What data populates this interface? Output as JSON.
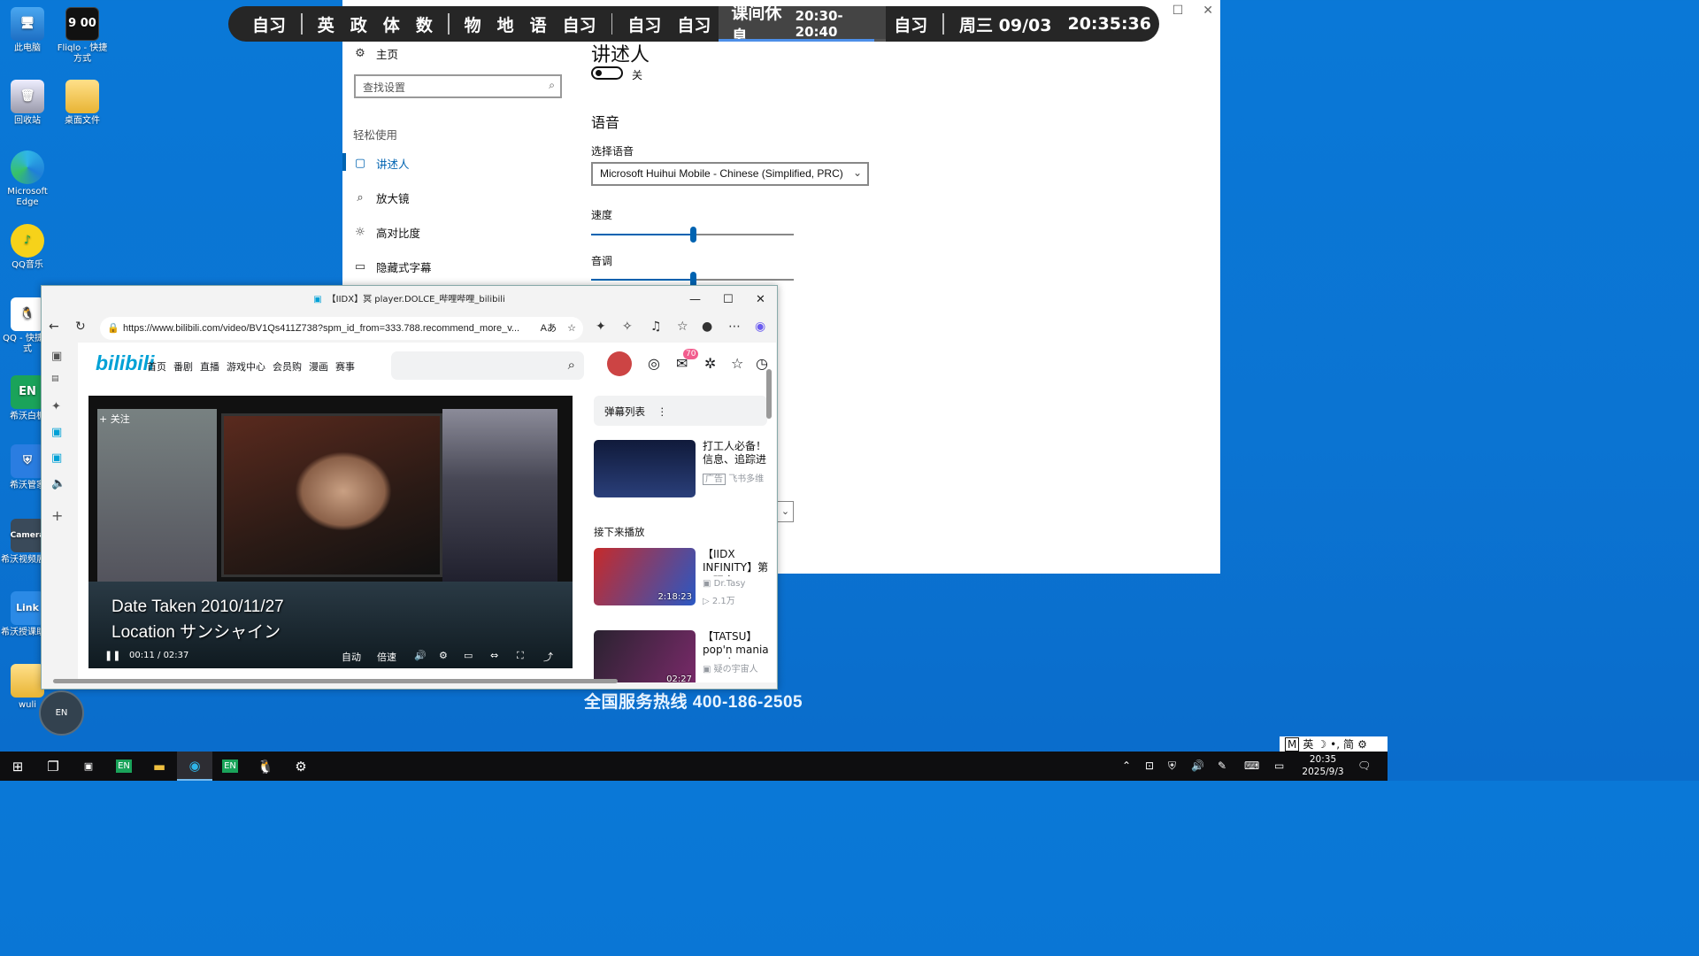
{
  "desktop": {
    "icons": [
      {
        "label": "此电脑",
        "icon": "computer-icon"
      },
      {
        "label": "Fliqlo - 快捷方式",
        "icon": "clock-icon",
        "ico_text": "9 00"
      },
      {
        "label": "回收站",
        "icon": "recycle-bin-icon"
      },
      {
        "label": "桌面文件",
        "icon": "folder-icon"
      },
      {
        "label": "Microsoft Edge",
        "icon": "edge-icon"
      },
      {
        "label": "QQ音乐",
        "icon": "qq-music-icon"
      },
      {
        "label": "QQ - 快捷方式",
        "icon": "qq-icon"
      },
      {
        "label": "希沃白板",
        "icon": "seewo-board-icon",
        "ico_text": "EN"
      },
      {
        "label": "希沃管家",
        "icon": "seewo-guard-icon"
      },
      {
        "label": "希沃视频展台",
        "icon": "camera-icon",
        "ico_text": "Camera"
      },
      {
        "label": "希沃授课助手",
        "icon": "link-icon",
        "ico_text": "Link"
      },
      {
        "label": "wuli",
        "icon": "folder-icon"
      }
    ],
    "hotline": "全国服务热线 400-186-2505",
    "floating_label": "EN"
  },
  "schedule": {
    "items": [
      "自习",
      "英",
      "政",
      "体",
      "数",
      "物",
      "地",
      "语",
      "自习",
      "自习",
      "自习"
    ],
    "current_label": "课间休息",
    "current_time": "20:30-20:40",
    "current_progress": 0.93,
    "after": "自习",
    "date": "周三 09/03",
    "clock": "20:35:36"
  },
  "settings": {
    "nav": {
      "home": "主页",
      "search_placeholder": "查找设置",
      "category": "轻松使用",
      "items": [
        "讲述人",
        "放大镜",
        "高对比度",
        "隐藏式字幕"
      ]
    },
    "title": "讲述人",
    "toggle_state": "关",
    "section_voice": "语音",
    "choose_voice_label": "选择语音",
    "voice_value": "Microsoft Huihui Mobile - Chinese (Simplified, PRC)",
    "speed_label": "速度",
    "speed_value": 0.5,
    "pitch_label": "音调",
    "pitch_value": 0.5
  },
  "browser": {
    "tab_title": "【IIDX】冥 player.DOLCE_哔哩哔哩_bilibili",
    "url": "https://www.bilibili.com/video/BV1Qs411Z738?spm_id_from=333.788.recommend_more_v...",
    "bili": {
      "logo": "bilibili",
      "nav": [
        "首页",
        "番剧",
        "直播",
        "游戏中心",
        "会员购",
        "漫画",
        "赛事"
      ],
      "message_badge": "70",
      "video": {
        "follow": "+ 关注",
        "caption_line1": "Date Taken 2010/11/27",
        "caption_line2": "Location サンシャイン",
        "current_time": "00:11",
        "duration": "02:37",
        "auto_label": "自动",
        "speed_label": "倍速"
      },
      "danmaku_title": "弹幕列表",
      "ad": {
        "title": "打工人必备！信息、追踪进",
        "badge": "广告",
        "source": "飞书多维"
      },
      "next_label": "接下来播放",
      "recs": [
        {
          "title": "【IIDX INFINITY】第一玩家DOL",
          "author": "Dr.Tasy",
          "views": "2.1万",
          "duration": "2:18:23"
        },
        {
          "title": "【TATSU】pop'n mania IIDX之",
          "author": "疑の宇宙人",
          "duration": "02:27"
        }
      ]
    }
  },
  "taskbar": {
    "clock_time": "20:35",
    "clock_date": "2025/9/3",
    "ime": [
      "M",
      "英",
      "简"
    ]
  }
}
